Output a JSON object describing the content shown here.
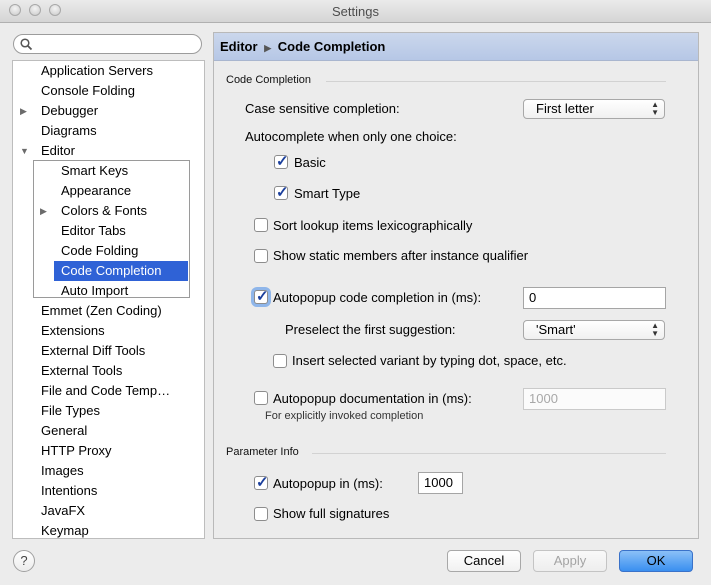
{
  "window": {
    "title": "Settings"
  },
  "search": {
    "placeholder": ""
  },
  "tree": {
    "items": [
      {
        "label": "Application Servers",
        "expandable": false
      },
      {
        "label": "Console Folding",
        "expandable": false
      },
      {
        "label": "Debugger",
        "expandable": true
      },
      {
        "label": "Diagrams",
        "expandable": false
      },
      {
        "label": "Editor",
        "expandable": true,
        "expanded": true
      },
      {
        "label": "Smart Keys",
        "expandable": false
      },
      {
        "label": "Appearance",
        "expandable": false
      },
      {
        "label": "Colors & Fonts",
        "expandable": true
      },
      {
        "label": "Editor Tabs",
        "expandable": false
      },
      {
        "label": "Code Folding",
        "expandable": false
      },
      {
        "label": "Code Completion",
        "expandable": false,
        "selected": true
      },
      {
        "label": "Auto Import",
        "expandable": false
      },
      {
        "label": "Emmet (Zen Coding)",
        "expandable": false
      },
      {
        "label": "Extensions",
        "expandable": false
      },
      {
        "label": "External Diff Tools",
        "expandable": false
      },
      {
        "label": "External Tools",
        "expandable": false
      },
      {
        "label": "File and Code Temp…",
        "expandable": false
      },
      {
        "label": "File Types",
        "expandable": false
      },
      {
        "label": "General",
        "expandable": false
      },
      {
        "label": "HTTP Proxy",
        "expandable": false
      },
      {
        "label": "Images",
        "expandable": false
      },
      {
        "label": "Intentions",
        "expandable": false
      },
      {
        "label": "JavaFX",
        "expandable": false
      },
      {
        "label": "Keymap",
        "expandable": false
      }
    ]
  },
  "breadcrumb": {
    "parent": "Editor",
    "current": "Code Completion"
  },
  "code_completion": {
    "section_title": "Code Completion",
    "case_sensitive_label": "Case sensitive completion:",
    "case_sensitive_value": "First letter",
    "autocomplete_label": "Autocomplete when only one choice:",
    "basic_label": "Basic",
    "basic_checked": true,
    "smart_type_label": "Smart Type",
    "smart_type_checked": true,
    "sort_lookup_label": "Sort lookup items lexicographically",
    "sort_lookup_checked": false,
    "show_static_label": "Show static members after instance qualifier",
    "show_static_checked": false,
    "autopopup_completion_label": "Autopopup code completion in (ms):",
    "autopopup_completion_checked": true,
    "autopopup_completion_value": "0",
    "preselect_label": "Preselect the first suggestion:",
    "preselect_value": "'Smart'",
    "insert_variant_label": "Insert selected variant by typing dot, space, etc.",
    "insert_variant_checked": false,
    "autopopup_doc_label": "Autopopup documentation in (ms):",
    "autopopup_doc_checked": false,
    "autopopup_doc_value": "1000",
    "autopopup_doc_hint": "For explicitly invoked completion"
  },
  "parameter_info": {
    "section_title": "Parameter Info",
    "autopopup_label": "Autopopup in (ms):",
    "autopopup_checked": true,
    "autopopup_value": "1000",
    "full_signatures_label": "Show full signatures",
    "full_signatures_checked": false
  },
  "footer": {
    "help_label": "?",
    "cancel_label": "Cancel",
    "apply_label": "Apply",
    "ok_label": "OK"
  },
  "colors": {
    "selection": "#2f62d6",
    "header": "#b6c7e6",
    "ok_button": "#3a8ff0"
  }
}
